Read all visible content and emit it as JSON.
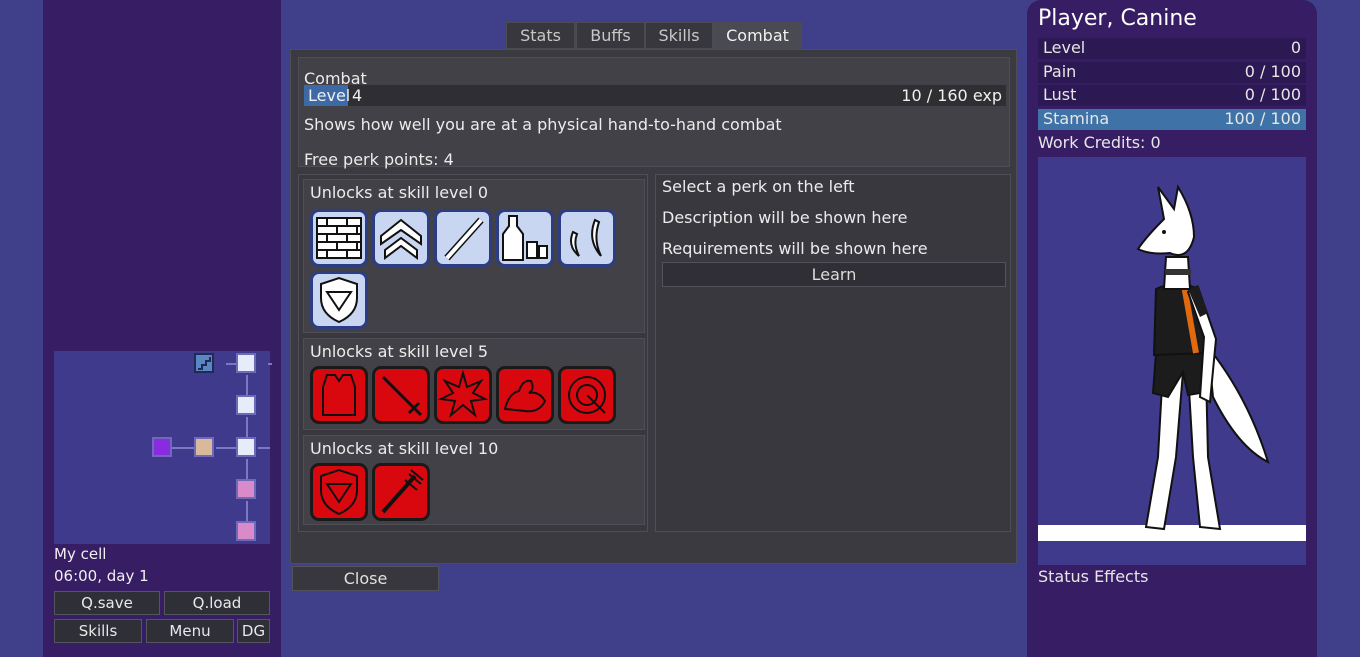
{
  "left_panel": {
    "location": "My cell",
    "time": "06:00, day 1",
    "buttons": {
      "qsave": "Q.save",
      "qload": "Q.load",
      "skills": "Skills",
      "menu": "Menu",
      "dg": "DG"
    }
  },
  "tabs": [
    {
      "label": "Stats",
      "active": false
    },
    {
      "label": "Buffs",
      "active": false
    },
    {
      "label": "Skills",
      "active": false
    },
    {
      "label": "Combat",
      "active": true
    }
  ],
  "skill": {
    "name": "Combat",
    "level_label": "Level",
    "level_value": "4",
    "exp": "10 / 160 exp",
    "exp_progress": 0.0625,
    "description": "Shows how well you are at a physical hand-to-hand combat",
    "free_perk_points": "Free perk points: 4"
  },
  "unlock_groups": [
    {
      "title": "Unlocks at skill level 0",
      "perks": [
        "brick-wall-icon",
        "rank-chevrons-icon",
        "staff-icon",
        "bottle-and-glass-icon",
        "claws-icon",
        "shield-icon"
      ],
      "style": "blue"
    },
    {
      "title": "Unlocks at skill level 5",
      "perks": [
        "armor-vest-icon",
        "sword-icon",
        "impact-burst-icon",
        "flexing-arm-icon",
        "whip-icon"
      ],
      "style": "red"
    },
    {
      "title": "Unlocks at skill level 10",
      "perks": [
        "red-shield-icon",
        "spiked-club-icon"
      ],
      "style": "red"
    }
  ],
  "perk_info": {
    "select_hint": "Select a perk on the left",
    "description_hint": "Description will be shown here",
    "requirements_hint": "Requirements will be shown here",
    "learn_label": "Learn"
  },
  "close_label": "Close",
  "player": {
    "name": "Player, Canine",
    "stats": [
      {
        "label": "Level",
        "value": "0"
      },
      {
        "label": "Pain",
        "value": "0 / 100"
      },
      {
        "label": "Lust",
        "value": "0 / 100"
      },
      {
        "label": "Stamina",
        "value": "100 / 100"
      }
    ],
    "work_credits": "Work Credits: 0",
    "status_effects_label": "Status Effects"
  },
  "colors": {
    "background": "#403f8a",
    "panel": "#371d63",
    "accent_blue": "#3f73a8",
    "perk_red": "#d8080e",
    "perk_blue": "#c9d6f2"
  }
}
